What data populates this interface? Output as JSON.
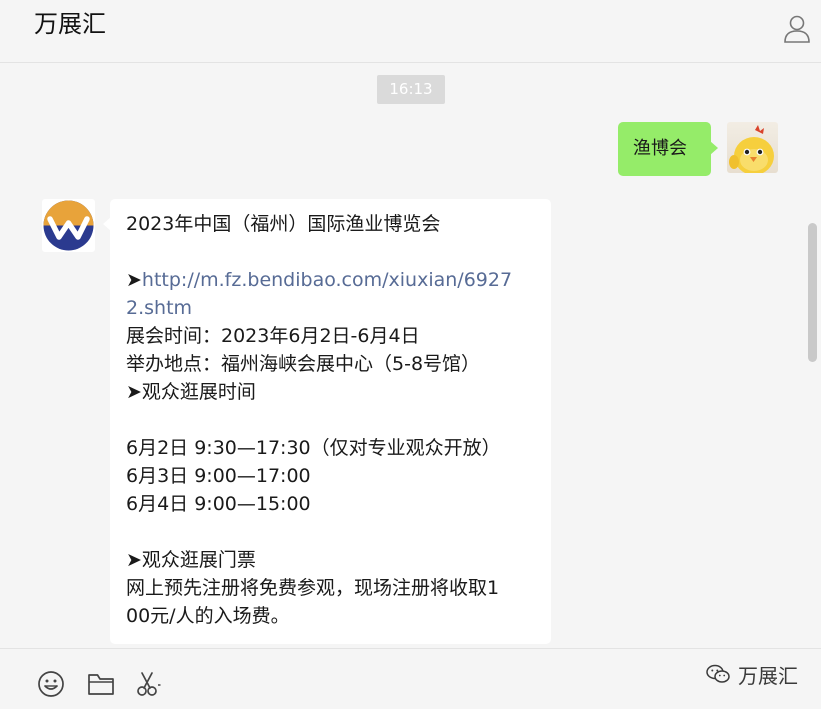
{
  "header": {
    "title": "万展汇"
  },
  "chat": {
    "timestamp": "16:13",
    "sent_message": "渔博会",
    "received_lines": [
      "2023年中国（福州）国际渔业博览会",
      "",
      "➤",
      "http://m.fz.bendibao.com/xiuxian/6927",
      "2.shtm",
      "展会时间：2023年6月2日-6月4日",
      "举办地点：福州海峡会展中心（5-8号馆）",
      "➤观众逛展时间",
      "",
      "6月2日 9:30—17:30（仅对专业观众开放）",
      "6月3日 9:00—17:00",
      "6月4日 9:00—15:00",
      "",
      "➤观众逛展门票",
      "网上预先注册将免费参观，现场注册将收取1",
      "00元/人的入场费。"
    ]
  },
  "toolbar": {
    "icons": [
      "emoji-icon",
      "folder-icon",
      "scissors-icon"
    ]
  },
  "watermark": {
    "text": "万展汇"
  },
  "colors": {
    "background": "#f5f5f5",
    "sent_bubble": "#95ec69",
    "received_bubble": "#ffffff",
    "link": "#576b95",
    "timestamp_bg": "#dadada",
    "brand_blue": "#2b3a8f",
    "brand_yellow": "#e8a33a"
  }
}
